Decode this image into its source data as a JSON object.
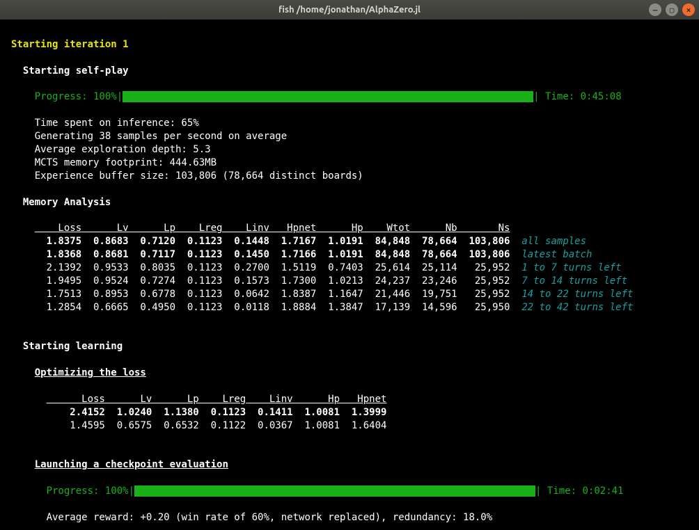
{
  "window": {
    "title": "fish  /home/jonathan/AlphaZero.jl"
  },
  "iteration_header": "Starting iteration 1",
  "selfplay": {
    "header": "Starting self-play",
    "progress_label": "Progress: 100%",
    "time_label": "Time: 0:45:08",
    "stats": [
      "Time spent on inference: 65%",
      "Generating 38 samples per second on average",
      "Average exploration depth: 5.3",
      "MCTS memory footprint: 444.63MB",
      "Experience buffer size: 103,806 (78,664 distinct boards)"
    ]
  },
  "memory": {
    "header": "Memory Analysis",
    "columns": [
      "Loss",
      "Lv",
      "Lp",
      "Lreg",
      "Linv",
      "Hpnet",
      "Hp",
      "Wtot",
      "Nb",
      "Ns"
    ],
    "rows": [
      {
        "v": [
          "1.8375",
          "0.8683",
          "0.7120",
          "0.1123",
          "0.1448",
          "1.7167",
          "1.0191",
          "84,848",
          "78,664",
          "103,806"
        ],
        "note": "all samples",
        "bold": true
      },
      {
        "v": [
          "1.8368",
          "0.8681",
          "0.7117",
          "0.1123",
          "0.1450",
          "1.7166",
          "1.0191",
          "84,848",
          "78,664",
          "103,806"
        ],
        "note": "latest batch",
        "bold": true
      },
      {
        "v": [
          "2.1392",
          "0.9533",
          "0.8035",
          "0.1123",
          "0.2700",
          "1.5119",
          "0.7403",
          "25,614",
          "25,114",
          "25,952"
        ],
        "note": "1 to 7 turns left",
        "bold": false
      },
      {
        "v": [
          "1.9495",
          "0.9524",
          "0.7274",
          "0.1123",
          "0.1573",
          "1.7300",
          "1.0213",
          "24,237",
          "23,246",
          "25,952"
        ],
        "note": "7 to 14 turns left",
        "bold": false
      },
      {
        "v": [
          "1.7513",
          "0.8953",
          "0.6778",
          "0.1123",
          "0.0642",
          "1.8387",
          "1.1647",
          "21,446",
          "19,751",
          "25,952"
        ],
        "note": "14 to 22 turns left",
        "bold": false
      },
      {
        "v": [
          "1.2854",
          "0.6665",
          "0.4950",
          "0.1123",
          "0.0118",
          "1.8884",
          "1.3847",
          "17,139",
          "14,596",
          "25,950"
        ],
        "note": "22 to 42 turns left",
        "bold": false
      }
    ]
  },
  "learning": {
    "header": "Starting learning",
    "optimizing_header": "Optimizing the loss",
    "columns": [
      "Loss",
      "Lv",
      "Lp",
      "Lreg",
      "Linv",
      "Hp",
      "Hpnet"
    ],
    "rows": [
      {
        "v": [
          "2.4152",
          "1.0240",
          "1.1380",
          "0.1123",
          "0.1411",
          "1.0081",
          "1.3999"
        ],
        "bold": true
      },
      {
        "v": [
          "1.4595",
          "0.6575",
          "0.6532",
          "0.1122",
          "0.0367",
          "1.0081",
          "1.6404"
        ],
        "bold": false
      }
    ],
    "checkpoint_header": "Launching a checkpoint evaluation",
    "progress_label": "Progress: 100%",
    "time_label": "Time: 0:02:41",
    "result": "Average reward: +0.20 (win rate of 60%, network replaced), redundancy: 18.0%"
  }
}
